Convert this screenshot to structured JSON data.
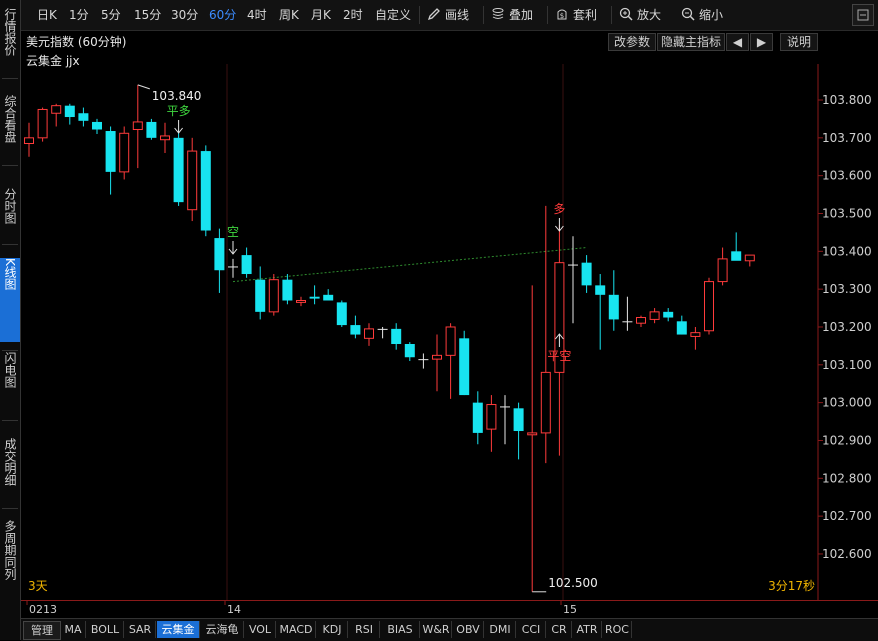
{
  "sidebar": {
    "items": [
      {
        "label": "行情报价",
        "active": false
      },
      {
        "label": "综合看盘",
        "active": false
      },
      {
        "label": "分时图",
        "active": false
      },
      {
        "label": "K线图",
        "active": true
      },
      {
        "label": "闪电图",
        "active": false
      },
      {
        "label": "成交明细",
        "active": false
      },
      {
        "label": "多周期同列",
        "active": false
      }
    ]
  },
  "toolbar": {
    "periods": [
      "日K",
      "1分",
      "5分",
      "15分",
      "30分",
      "60分",
      "4时",
      "周K",
      "月K",
      "2时",
      "自定义"
    ],
    "active_period": "60分",
    "tools": [
      {
        "label": "画线",
        "icon": "pencil-icon"
      },
      {
        "label": "叠加",
        "icon": "stack-icon"
      },
      {
        "label": "套利",
        "icon": "arbitrage-icon"
      },
      {
        "label": "放大",
        "icon": "zoom-in-icon"
      },
      {
        "label": "缩小",
        "icon": "zoom-out-icon"
      }
    ],
    "close_icon": "panel-toggle-icon"
  },
  "header": {
    "title": "美元指数 (60分钟)",
    "buttons": [
      "改参数",
      "隐藏主指标",
      "◀",
      "▶",
      "说明"
    ],
    "subtitle": "云集金 jjx"
  },
  "chart": {
    "y_ticks": [
      "103.800",
      "103.700",
      "103.600",
      "103.500",
      "103.400",
      "103.300",
      "103.200",
      "103.100",
      "103.000",
      "102.900",
      "102.800",
      "102.700",
      "102.600"
    ],
    "x_labels": [
      "0213",
      "14",
      "15"
    ],
    "days_label": "3天",
    "countdown": "3分17秒",
    "high_label": "103.840",
    "low_label": "102.500",
    "signals": [
      {
        "text": "平多",
        "color": "#3fd63f"
      },
      {
        "text": "空",
        "color": "#3fd63f"
      },
      {
        "text": "多",
        "color": "#ff3b3b"
      },
      {
        "text": "平空",
        "color": "#ff3b3b"
      }
    ],
    "colors": {
      "up": "#ff3b3b",
      "down": "#18e4f0",
      "axis": "#8a1a1a",
      "dash": "#2e8b2e"
    }
  },
  "chart_data": {
    "type": "candlestick",
    "ylim": [
      102.5,
      103.87
    ],
    "candles": [
      {
        "o": 103.685,
        "h": 103.74,
        "l": 103.65,
        "c": 103.7
      },
      {
        "o": 103.7,
        "h": 103.78,
        "l": 103.69,
        "c": 103.775
      },
      {
        "o": 103.765,
        "h": 103.79,
        "l": 103.73,
        "c": 103.785
      },
      {
        "o": 103.785,
        "h": 103.79,
        "l": 103.735,
        "c": 103.755
      },
      {
        "o": 103.765,
        "h": 103.78,
        "l": 103.73,
        "c": 103.745
      },
      {
        "o": 103.742,
        "h": 103.75,
        "l": 103.71,
        "c": 103.722
      },
      {
        "o": 103.718,
        "h": 103.73,
        "l": 103.55,
        "c": 103.61
      },
      {
        "o": 103.61,
        "h": 103.73,
        "l": 103.59,
        "c": 103.712
      },
      {
        "o": 103.722,
        "h": 103.84,
        "l": 103.62,
        "c": 103.742
      },
      {
        "o": 103.742,
        "h": 103.75,
        "l": 103.695,
        "c": 103.7
      },
      {
        "o": 103.695,
        "h": 103.74,
        "l": 103.66,
        "c": 103.705
      },
      {
        "o": 103.7,
        "h": 103.72,
        "l": 103.52,
        "c": 103.53
      },
      {
        "o": 103.51,
        "h": 103.7,
        "l": 103.48,
        "c": 103.665
      },
      {
        "o": 103.665,
        "h": 103.68,
        "l": 103.44,
        "c": 103.455
      },
      {
        "o": 103.435,
        "h": 103.46,
        "l": 103.29,
        "c": 103.35
      },
      {
        "o": 103.36,
        "h": 103.38,
        "l": 103.33,
        "c": 103.36
      },
      {
        "o": 103.39,
        "h": 103.41,
        "l": 103.33,
        "c": 103.34
      },
      {
        "o": 103.325,
        "h": 103.36,
        "l": 103.22,
        "c": 103.24
      },
      {
        "o": 103.24,
        "h": 103.34,
        "l": 103.23,
        "c": 103.325
      },
      {
        "o": 103.325,
        "h": 103.34,
        "l": 103.26,
        "c": 103.27
      },
      {
        "o": 103.265,
        "h": 103.28,
        "l": 103.255,
        "c": 103.27
      },
      {
        "o": 103.28,
        "h": 103.31,
        "l": 103.26,
        "c": 103.275
      },
      {
        "o": 103.285,
        "h": 103.3,
        "l": 103.27,
        "c": 103.27
      },
      {
        "o": 103.265,
        "h": 103.27,
        "l": 103.2,
        "c": 103.205
      },
      {
        "o": 103.205,
        "h": 103.23,
        "l": 103.17,
        "c": 103.18
      },
      {
        "o": 103.17,
        "h": 103.21,
        "l": 103.15,
        "c": 103.195
      },
      {
        "o": 103.195,
        "h": 103.2,
        "l": 103.17,
        "c": 103.195
      },
      {
        "o": 103.195,
        "h": 103.21,
        "l": 103.14,
        "c": 103.155
      },
      {
        "o": 103.155,
        "h": 103.16,
        "l": 103.11,
        "c": 103.12
      },
      {
        "o": 103.115,
        "h": 103.13,
        "l": 103.09,
        "c": 103.115
      },
      {
        "o": 103.115,
        "h": 103.18,
        "l": 103.03,
        "c": 103.125
      },
      {
        "o": 103.125,
        "h": 103.21,
        "l": 103.01,
        "c": 103.2
      },
      {
        "o": 103.17,
        "h": 103.19,
        "l": 103.02,
        "c": 103.02
      },
      {
        "o": 103.0,
        "h": 103.03,
        "l": 102.89,
        "c": 102.92
      },
      {
        "o": 102.93,
        "h": 103.02,
        "l": 102.87,
        "c": 102.995
      },
      {
        "o": 102.99,
        "h": 103.02,
        "l": 102.89,
        "c": 102.99
      },
      {
        "o": 102.985,
        "h": 103.0,
        "l": 102.85,
        "c": 102.925
      },
      {
        "o": 102.915,
        "h": 103.31,
        "l": 102.5,
        "c": 102.92
      },
      {
        "o": 102.92,
        "h": 103.52,
        "l": 102.84,
        "c": 103.08
      },
      {
        "o": 103.08,
        "h": 103.47,
        "l": 102.86,
        "c": 103.37
      },
      {
        "o": 103.365,
        "h": 103.44,
        "l": 103.21,
        "c": 103.365
      },
      {
        "o": 103.37,
        "h": 103.39,
        "l": 103.29,
        "c": 103.31
      },
      {
        "o": 103.31,
        "h": 103.34,
        "l": 103.14,
        "c": 103.285
      },
      {
        "o": 103.285,
        "h": 103.35,
        "l": 103.19,
        "c": 103.22
      },
      {
        "o": 103.215,
        "h": 103.28,
        "l": 103.19,
        "c": 103.215
      },
      {
        "o": 103.21,
        "h": 103.23,
        "l": 103.2,
        "c": 103.225
      },
      {
        "o": 103.22,
        "h": 103.25,
        "l": 103.21,
        "c": 103.24
      },
      {
        "o": 103.24,
        "h": 103.25,
        "l": 103.215,
        "c": 103.225
      },
      {
        "o": 103.215,
        "h": 103.23,
        "l": 103.18,
        "c": 103.18
      },
      {
        "o": 103.175,
        "h": 103.2,
        "l": 103.14,
        "c": 103.185
      },
      {
        "o": 103.19,
        "h": 103.33,
        "l": 103.18,
        "c": 103.32
      },
      {
        "o": 103.32,
        "h": 103.41,
        "l": 103.31,
        "c": 103.38
      },
      {
        "o": 103.4,
        "h": 103.45,
        "l": 103.38,
        "c": 103.375
      },
      {
        "o": 103.375,
        "h": 103.39,
        "l": 103.36,
        "c": 103.39
      }
    ],
    "trendline": {
      "from": [
        15,
        103.32
      ],
      "to": [
        41,
        103.41
      ]
    }
  }
}
